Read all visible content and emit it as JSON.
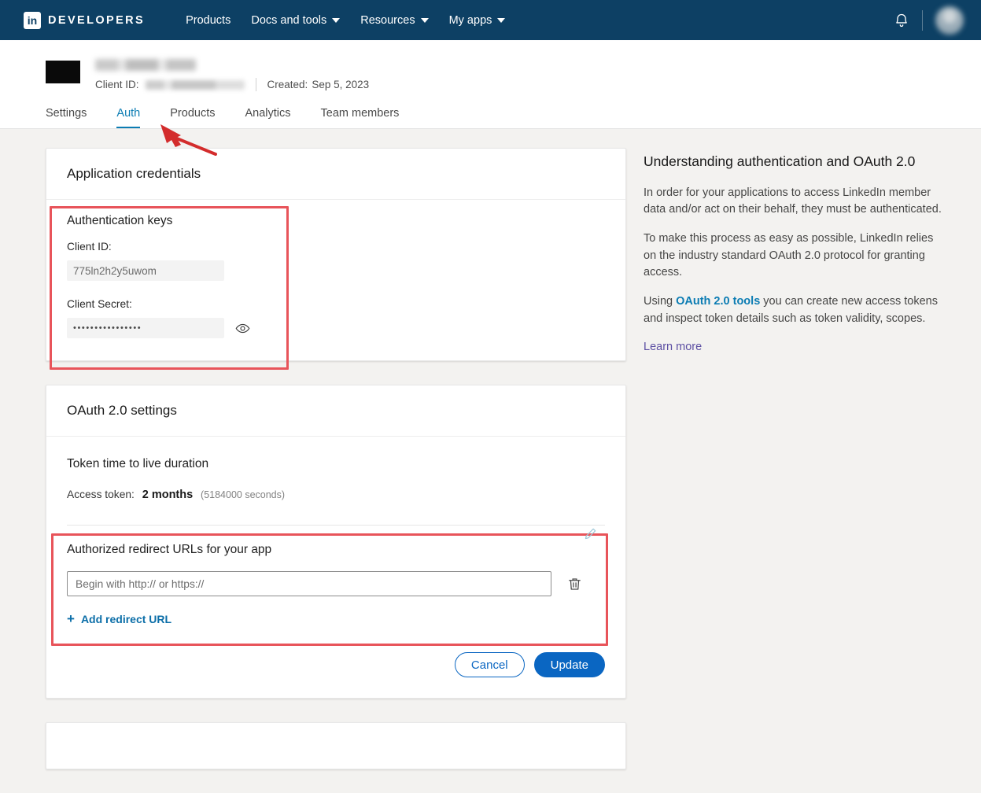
{
  "topnav": {
    "brand": "DEVELOPERS",
    "logo_glyph": "in",
    "items": [
      {
        "label": "Products",
        "has_caret": false
      },
      {
        "label": "Docs and tools",
        "has_caret": true
      },
      {
        "label": "Resources",
        "has_caret": true
      },
      {
        "label": "My apps",
        "has_caret": true
      }
    ],
    "bell_icon": "notifications-bell-icon",
    "avatar": "user-avatar"
  },
  "appheader": {
    "client_id_label": "Client ID:",
    "created_label": "Created:",
    "created_value": "Sep 5, 2023"
  },
  "tabs": [
    {
      "label": "Settings",
      "active": false
    },
    {
      "label": "Auth",
      "active": true
    },
    {
      "label": "Products",
      "active": false
    },
    {
      "label": "Analytics",
      "active": false
    },
    {
      "label": "Team members",
      "active": false
    }
  ],
  "credentials_card": {
    "header": "Application credentials",
    "section_title": "Authentication keys",
    "client_id_label": "Client ID:",
    "client_id_value": "775ln2h2y5uwom",
    "client_secret_label": "Client Secret:",
    "client_secret_masked": "••••••••••••••••",
    "reveal_icon": "eye-icon"
  },
  "oauth_card": {
    "header": "OAuth 2.0 settings",
    "ttl_title": "Token time to live duration",
    "access_token_label": "Access token:",
    "access_token_value": "2 months",
    "access_token_seconds": "(5184000 seconds)",
    "redirect_title": "Authorized redirect URLs for your app",
    "redirect_placeholder": "Begin with http:// or https://",
    "redirect_value": "",
    "add_redirect_label": "Add redirect URL",
    "add_plus": "+",
    "edit_icon": "pencil-edit-icon",
    "delete_icon": "trash-delete-icon",
    "cancel_label": "Cancel",
    "update_label": "Update"
  },
  "sidebar": {
    "title": "Understanding authentication and OAuth 2.0",
    "p1": "In order for your applications to access LinkedIn member data and/or act on their behalf, they must be authenticated.",
    "p2": "To make this process as easy as possible, LinkedIn relies on the industry standard OAuth 2.0 protocol for granting access.",
    "p3_before": "Using ",
    "p3_link": "OAuth 2.0 tools",
    "p3_after": " you can create new access tokens and inspect token details such as token validity, scopes.",
    "learn_more": "Learn more"
  },
  "colors": {
    "nav_background": "#0d4064",
    "accent_blue": "#0a66c2",
    "tab_active": "#0b7cb3",
    "annotation_red": "#e8545a",
    "visited_link": "#5c4fa3",
    "page_background": "#f3f2f0"
  }
}
